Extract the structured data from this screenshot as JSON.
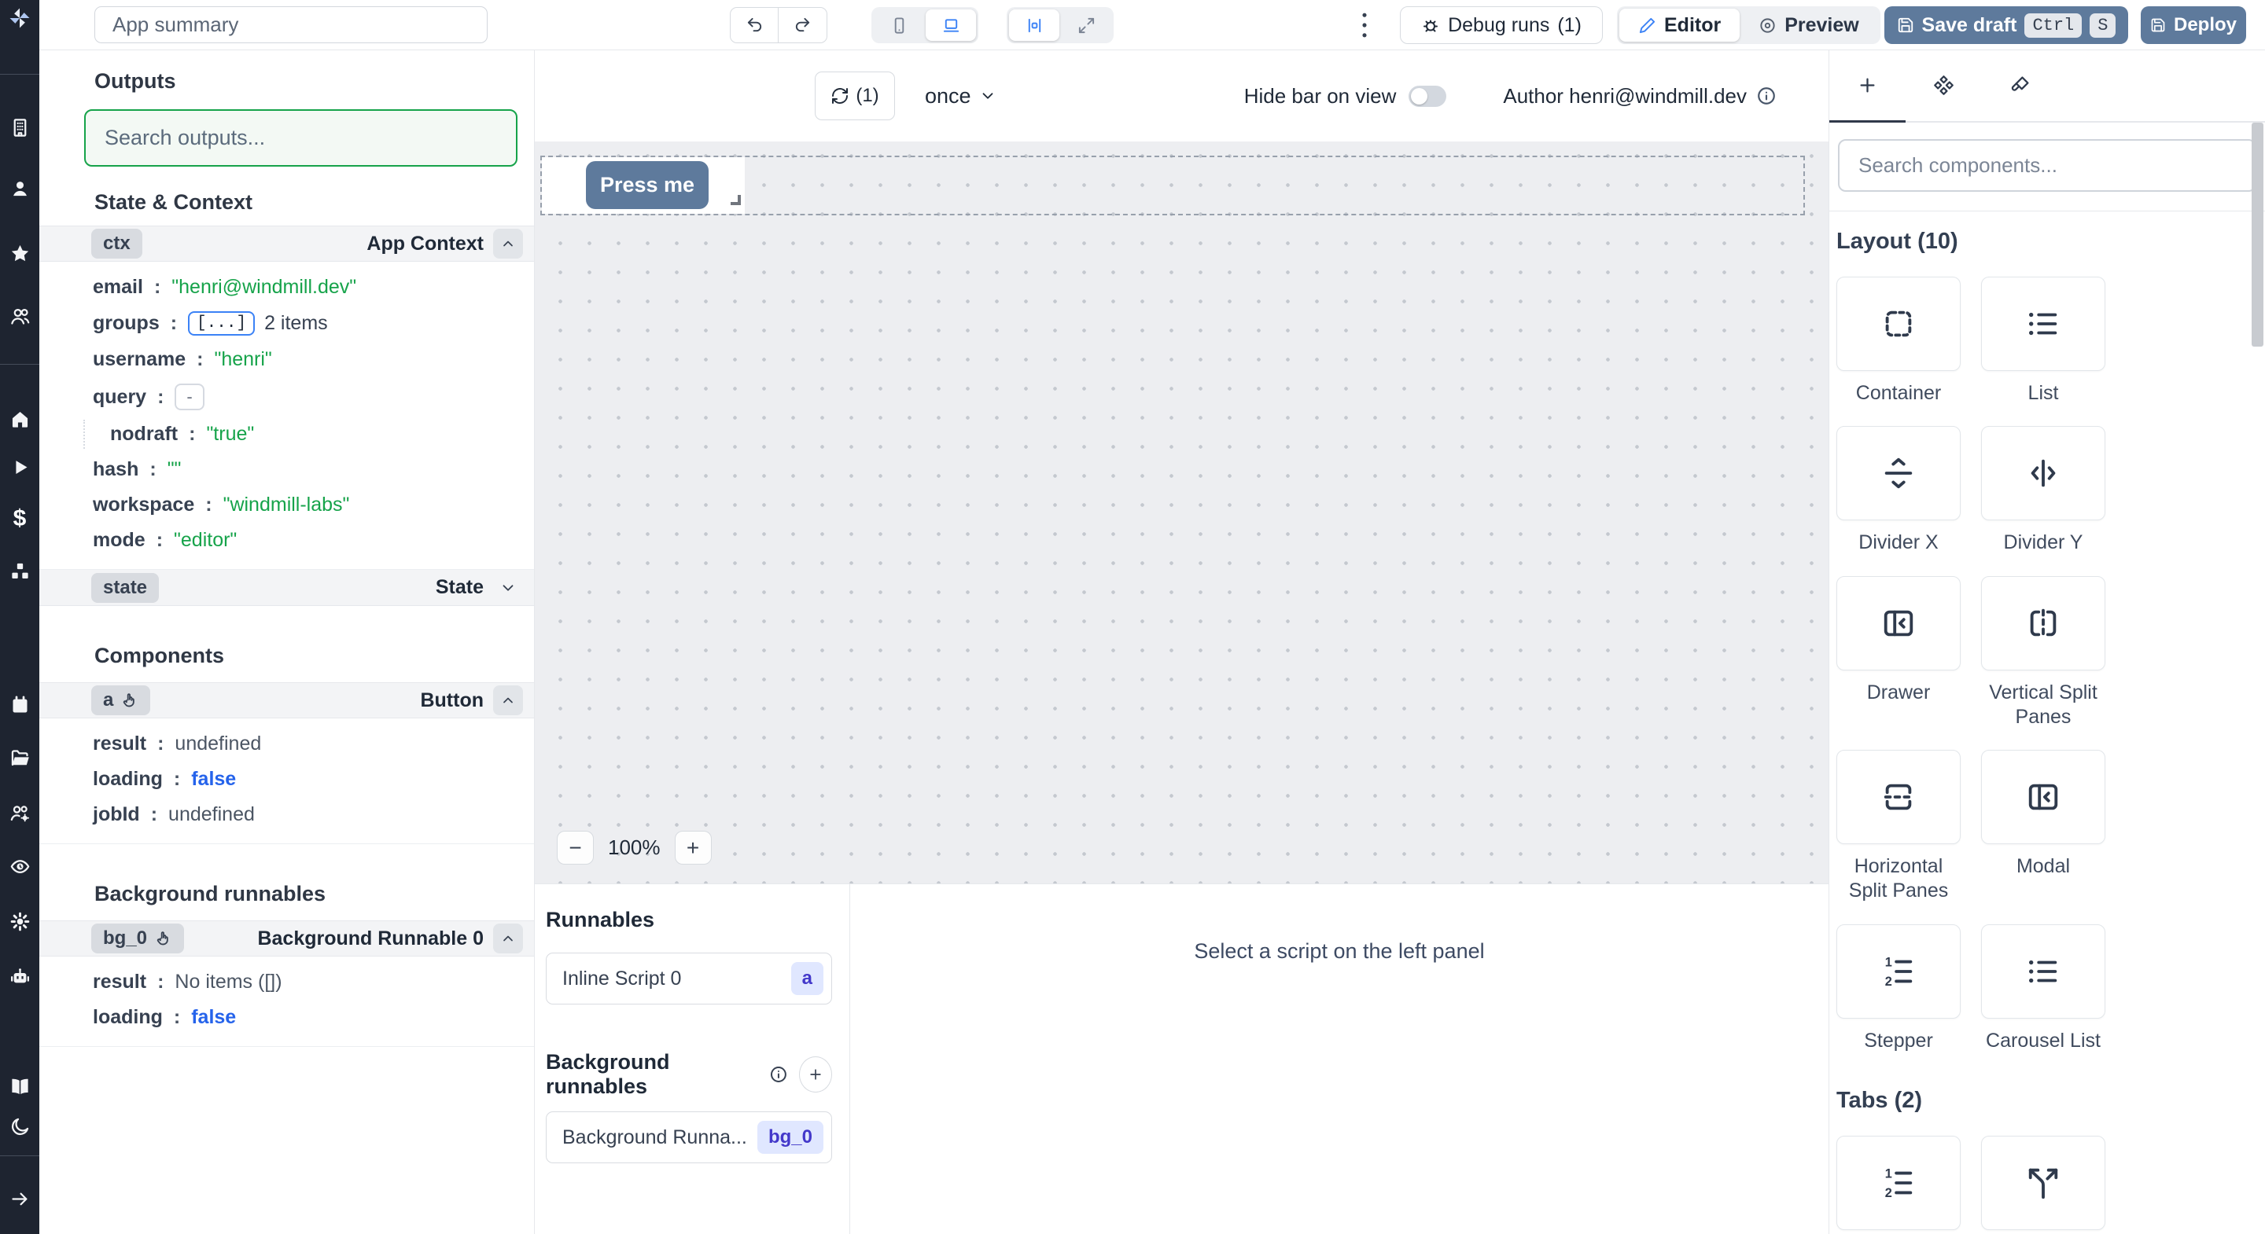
{
  "topbar": {
    "app_summary": "App summary",
    "debug_runs": "Debug runs",
    "debug_count": "(1)",
    "editor": "Editor",
    "preview": "Preview",
    "save_draft": "Save draft",
    "kbd_ctrl": "Ctrl",
    "kbd_s": "S",
    "deploy": "Deploy"
  },
  "sidebar_icons": [
    "windmill-logo",
    "workspace-building",
    "user",
    "favorites-star",
    "groups-users",
    "home",
    "runs-play",
    "billing-dollar",
    "resources-boxes",
    "schedules-calendar",
    "folders-folder-open",
    "groups-settings",
    "audit-logs-eye",
    "settings-gear",
    "workers-robot",
    "docs-book-open",
    "dark-mode-moon",
    "expand-sidebar-arrow-right"
  ],
  "outputs": {
    "title": "Outputs",
    "search_placeholder": "Search outputs...",
    "state_context_title": "State & Context",
    "ctx": {
      "chip": "ctx",
      "label": "App Context",
      "rows": [
        {
          "key": "email",
          "value": "\"henri@windmill.dev\""
        },
        {
          "key": "groups",
          "badge": "[...]",
          "suffix": "2 items"
        },
        {
          "key": "username",
          "value": "\"henri\""
        },
        {
          "key": "query",
          "badge": "-"
        },
        {
          "key": "nodraft",
          "value": "\"true\""
        },
        {
          "key": "hash",
          "value": "\"\""
        },
        {
          "key": "workspace",
          "value": "\"windmill-labs\""
        },
        {
          "key": "mode",
          "value": "\"editor\""
        }
      ]
    },
    "state": {
      "chip": "state",
      "label": "State"
    },
    "components_title": "Components",
    "button_component": {
      "chip": "a",
      "label": "Button",
      "rows": [
        {
          "key": "result",
          "value": "undefined"
        },
        {
          "key": "loading",
          "value": "false"
        },
        {
          "key": "jobId",
          "value": "undefined"
        }
      ]
    },
    "background_title": "Background runnables",
    "bg_runnable": {
      "chip": "bg_0",
      "label": "Background Runnable 0",
      "rows": [
        {
          "key": "result",
          "value": "No items ([])"
        },
        {
          "key": "loading",
          "value": "false"
        }
      ]
    }
  },
  "canvas": {
    "refresh_count": "(1)",
    "schedule": "once",
    "hide_bar": "Hide bar on view",
    "author": "Author henri@windmill.dev",
    "press_me": "Press me",
    "zoom_out": "−",
    "zoom_level": "100%",
    "zoom_in": "+"
  },
  "runnables": {
    "title": "Runnables",
    "inline_script": {
      "name": "Inline Script 0",
      "badge": "a"
    },
    "background_title": "Background runnables",
    "background_item": {
      "name": "Background Runna...",
      "badge": "bg_0"
    },
    "hint": "Select a script on the left panel"
  },
  "components": {
    "search_placeholder": "Search components...",
    "layout_title": "Layout (10)",
    "items": [
      "Container",
      "List",
      "Divider X",
      "Divider Y",
      "Drawer",
      "Vertical Split Panes",
      "Horizontal Split Panes",
      "Modal",
      "Stepper",
      "Carousel List"
    ],
    "tabs_title": "Tabs (2)"
  },
  "colors": {
    "sidebar_bg": "#1e2430",
    "primary_button": "#5e7a9c",
    "selected_icon_blue": "#3b82f6",
    "string_green": "#16a34a",
    "bool_blue": "#2563eb",
    "search_focus_green": "#16a34a",
    "badge_indigo_bg": "#e0e7ff",
    "badge_indigo_text": "#4338ca"
  }
}
